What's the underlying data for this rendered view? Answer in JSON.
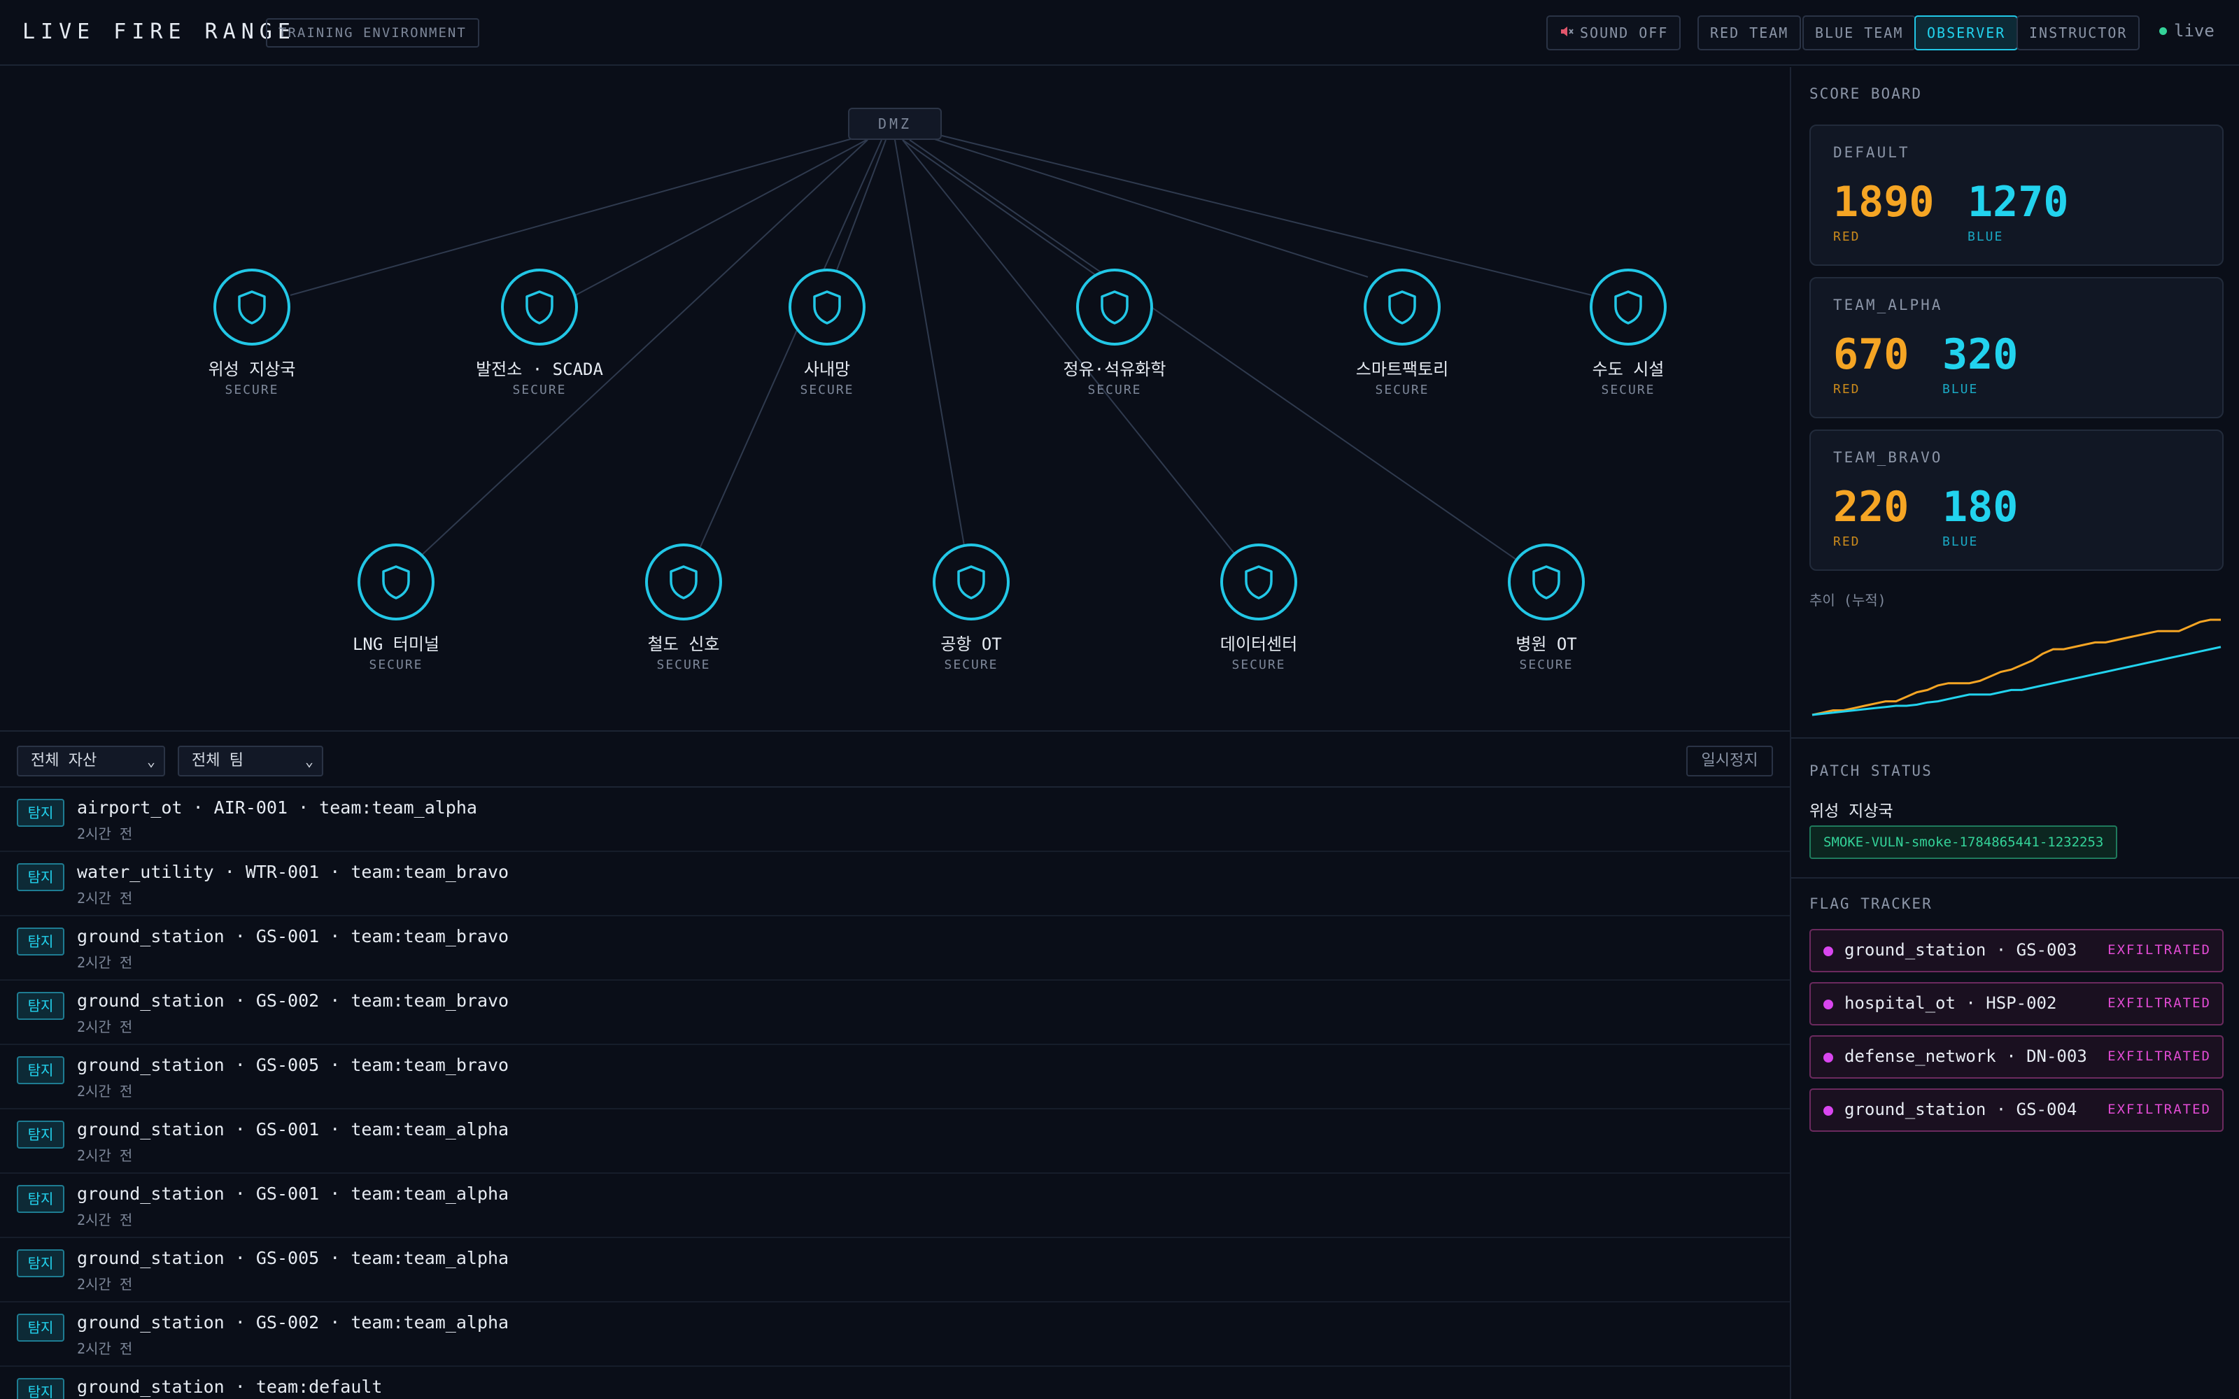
{
  "header": {
    "title": "LIVE FIRE RANGE",
    "env_badge": "TRAINING ENVIRONMENT",
    "sound_label": "SOUND OFF",
    "sound_icon": "speaker-muted-icon",
    "team_buttons": [
      "RED TEAM",
      "BLUE TEAM",
      "OBSERVER",
      "INSTRUCTOR"
    ],
    "active_team": "OBSERVER",
    "live_label": "live"
  },
  "map": {
    "hub_label": "DMZ",
    "nodes": [
      {
        "name": "위성 지상국",
        "status": "SECURE"
      },
      {
        "name": "발전소 · SCADA",
        "status": "SECURE"
      },
      {
        "name": "사내망",
        "status": "SECURE"
      },
      {
        "name": "정유·석유화학",
        "status": "SECURE"
      },
      {
        "name": "스마트팩토리",
        "status": "SECURE"
      },
      {
        "name": "수도 시설",
        "status": "SECURE"
      },
      {
        "name": "LNG 터미널",
        "status": "SECURE"
      },
      {
        "name": "철도 신호",
        "status": "SECURE"
      },
      {
        "name": "공항 OT",
        "status": "SECURE"
      },
      {
        "name": "데이터센터",
        "status": "SECURE"
      },
      {
        "name": "병원 OT",
        "status": "SECURE"
      }
    ]
  },
  "feed": {
    "asset_filter": "전체 자산",
    "team_filter": "전체 팀",
    "pause_label": "일시정지",
    "events": [
      {
        "tag": "탐지",
        "text": "airport_ot · AIR-001 · team:team_alpha",
        "time": "2시간 전"
      },
      {
        "tag": "탐지",
        "text": "water_utility · WTR-001 · team:team_bravo",
        "time": "2시간 전"
      },
      {
        "tag": "탐지",
        "text": "ground_station · GS-001 · team:team_bravo",
        "time": "2시간 전"
      },
      {
        "tag": "탐지",
        "text": "ground_station · GS-002 · team:team_bravo",
        "time": "2시간 전"
      },
      {
        "tag": "탐지",
        "text": "ground_station · GS-005 · team:team_bravo",
        "time": "2시간 전"
      },
      {
        "tag": "탐지",
        "text": "ground_station · GS-001 · team:team_alpha",
        "time": "2시간 전"
      },
      {
        "tag": "탐지",
        "text": "ground_station · GS-001 · team:team_alpha",
        "time": "2시간 전"
      },
      {
        "tag": "탐지",
        "text": "ground_station · GS-005 · team:team_alpha",
        "time": "2시간 전"
      },
      {
        "tag": "탐지",
        "text": "ground_station · GS-002 · team:team_alpha",
        "time": "2시간 전"
      },
      {
        "tag": "탐지",
        "text": "ground_station · team:default",
        "time": ""
      }
    ]
  },
  "scoreboard": {
    "title": "SCORE BOARD",
    "red_label": "RED",
    "blue_label": "BLUE",
    "teams": [
      {
        "name": "DEFAULT",
        "red": "1890",
        "blue": "1270"
      },
      {
        "name": "TEAM_ALPHA",
        "red": "670",
        "blue": "320"
      },
      {
        "name": "TEAM_BRAVO",
        "red": "220",
        "blue": "180"
      }
    ],
    "trend_label": "추이 (누적)"
  },
  "trend_colors": {
    "red": "#f5a524",
    "blue": "#22d3ee"
  },
  "chart_data": {
    "type": "line",
    "title": "추이 (누적)",
    "series": [
      {
        "name": "RED",
        "values": [
          0,
          2,
          4,
          4,
          6,
          8,
          10,
          12,
          12,
          16,
          20,
          22,
          26,
          28,
          28,
          28,
          30,
          34,
          38,
          40,
          44,
          48,
          54,
          58,
          58,
          60,
          62,
          64,
          64,
          66,
          68,
          70,
          72,
          74,
          74,
          74,
          78,
          82,
          84,
          84
        ]
      },
      {
        "name": "BLUE",
        "values": [
          0,
          1,
          2,
          3,
          4,
          5,
          6,
          7,
          8,
          8,
          9,
          11,
          12,
          14,
          16,
          18,
          18,
          18,
          20,
          22,
          22,
          24,
          26,
          28,
          30,
          32,
          34,
          36,
          38,
          40,
          42,
          44,
          46,
          48,
          50,
          52,
          54,
          56,
          58,
          60
        ]
      }
    ]
  },
  "patch": {
    "title": "PATCH STATUS",
    "asset": "위성 지상국",
    "vuln_id": "SMOKE-VULN-smoke-1784865441-1232253"
  },
  "flags": {
    "title": "FLAG TRACKER",
    "items": [
      {
        "text": "ground_station · GS-003",
        "status": "EXFILTRATED"
      },
      {
        "text": "hospital_ot · HSP-002",
        "status": "EXFILTRATED"
      },
      {
        "text": "defense_network · DN-003",
        "status": "EXFILTRATED"
      },
      {
        "text": "ground_station · GS-004",
        "status": "EXFILTRATED"
      }
    ]
  }
}
